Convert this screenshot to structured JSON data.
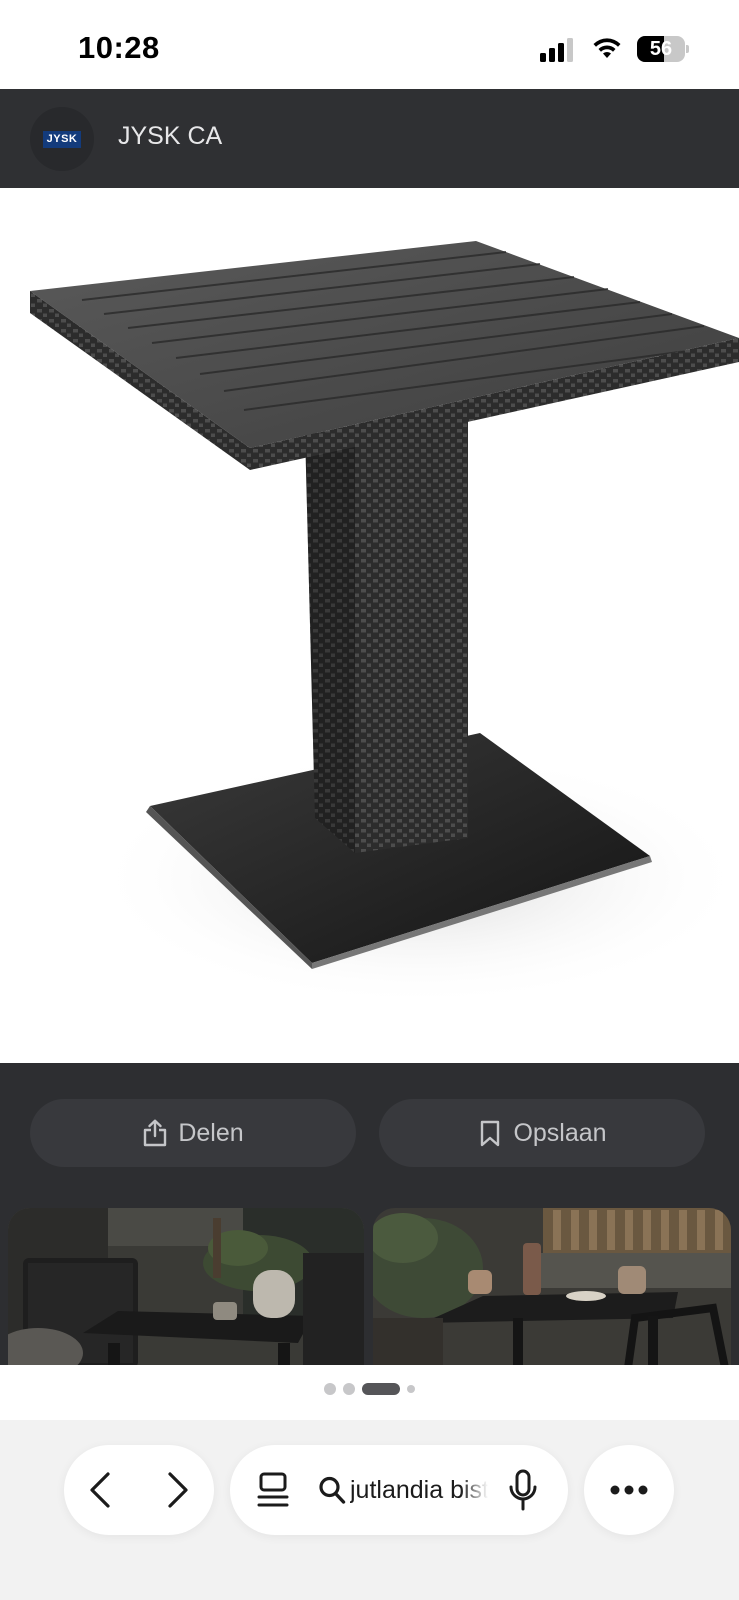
{
  "status_bar": {
    "time": "10:28",
    "battery_level": "56",
    "icons": [
      "cellular-signal-icon",
      "wifi-icon",
      "battery-icon"
    ]
  },
  "header": {
    "site_name": "JYSK CA",
    "logo_text": "JYSK"
  },
  "product": {
    "image_description_icon": "table-image"
  },
  "actions": {
    "share_label": "Delen",
    "save_label": "Opslaan",
    "share_icon": "share-icon",
    "save_icon": "bookmark-icon"
  },
  "related_images": [
    {
      "icon": "patio-table-photo"
    },
    {
      "icon": "patio-table-photo"
    }
  ],
  "pagination": {
    "total": 4,
    "active_index": 2
  },
  "browser_bar": {
    "url_text": "jutlandia bistro",
    "icons": [
      "back-icon",
      "forward-icon",
      "tabs-icon",
      "search-icon",
      "mic-icon",
      "more-icon"
    ]
  },
  "colors": {
    "header_bg": "#2f3033",
    "dark_area_bg": "#2d2e31",
    "pill_bg": "#38393d",
    "brand_blue": "#133b7c",
    "bottom_bar_bg": "#f2f2f2"
  }
}
